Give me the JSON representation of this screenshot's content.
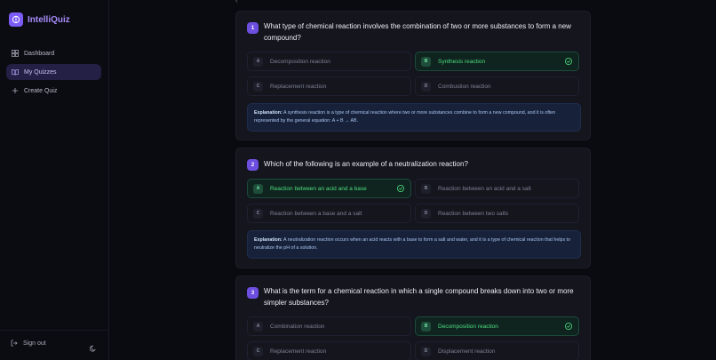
{
  "app": {
    "name": "IntelliQuiz",
    "logo_icon": "brain-icon",
    "accent": "#7c5cf6"
  },
  "sidebar": {
    "items": [
      {
        "label": "Dashboard",
        "icon": "dashboard-icon",
        "active": false
      },
      {
        "label": "My Quizzes",
        "icon": "book-open-icon",
        "active": true
      },
      {
        "label": "Create Quiz",
        "icon": "plus-icon",
        "active": false
      }
    ],
    "sign_out": "Sign out",
    "theme_icon": "moon-icon"
  },
  "questions": [
    {
      "number": "1",
      "text": "What type of chemical reaction involves the combination of two or more substances to form a new compound?",
      "options": [
        {
          "letter": "A",
          "label": "Decomposition reaction",
          "correct": false
        },
        {
          "letter": "B",
          "label": "Synthesis reaction",
          "correct": true
        },
        {
          "letter": "C",
          "label": "Replacement reaction",
          "correct": false
        },
        {
          "letter": "D",
          "label": "Combustion reaction",
          "correct": false
        }
      ],
      "explanation_label": "Explanation:",
      "explanation": "A synthesis reaction is a type of chemical reaction where two or more substances combine to form a new compound, and it is often represented by the general equation: A + B → AB."
    },
    {
      "number": "2",
      "text": "Which of the following is an example of a neutralization reaction?",
      "options": [
        {
          "letter": "A",
          "label": "Reaction between an acid and a base",
          "correct": true
        },
        {
          "letter": "B",
          "label": "Reaction between an acid and a salt",
          "correct": false
        },
        {
          "letter": "C",
          "label": "Reaction between a base and a salt",
          "correct": false
        },
        {
          "letter": "D",
          "label": "Reaction between two salts",
          "correct": false
        }
      ],
      "explanation_label": "Explanation:",
      "explanation": "A neutralization reaction occurs when an acid reacts with a base to form a salt and water, and it is a type of chemical reaction that helps to neutralize the pH of a solution."
    },
    {
      "number": "3",
      "text": "What is the term for a chemical reaction in which a single compound breaks down into two or more simpler substances?",
      "options": [
        {
          "letter": "A",
          "label": "Combination reaction",
          "correct": false
        },
        {
          "letter": "B",
          "label": "Decomposition reaction",
          "correct": true
        },
        {
          "letter": "C",
          "label": "Replacement reaction",
          "correct": false
        },
        {
          "letter": "D",
          "label": "Displacement reaction",
          "correct": false
        }
      ]
    }
  ]
}
